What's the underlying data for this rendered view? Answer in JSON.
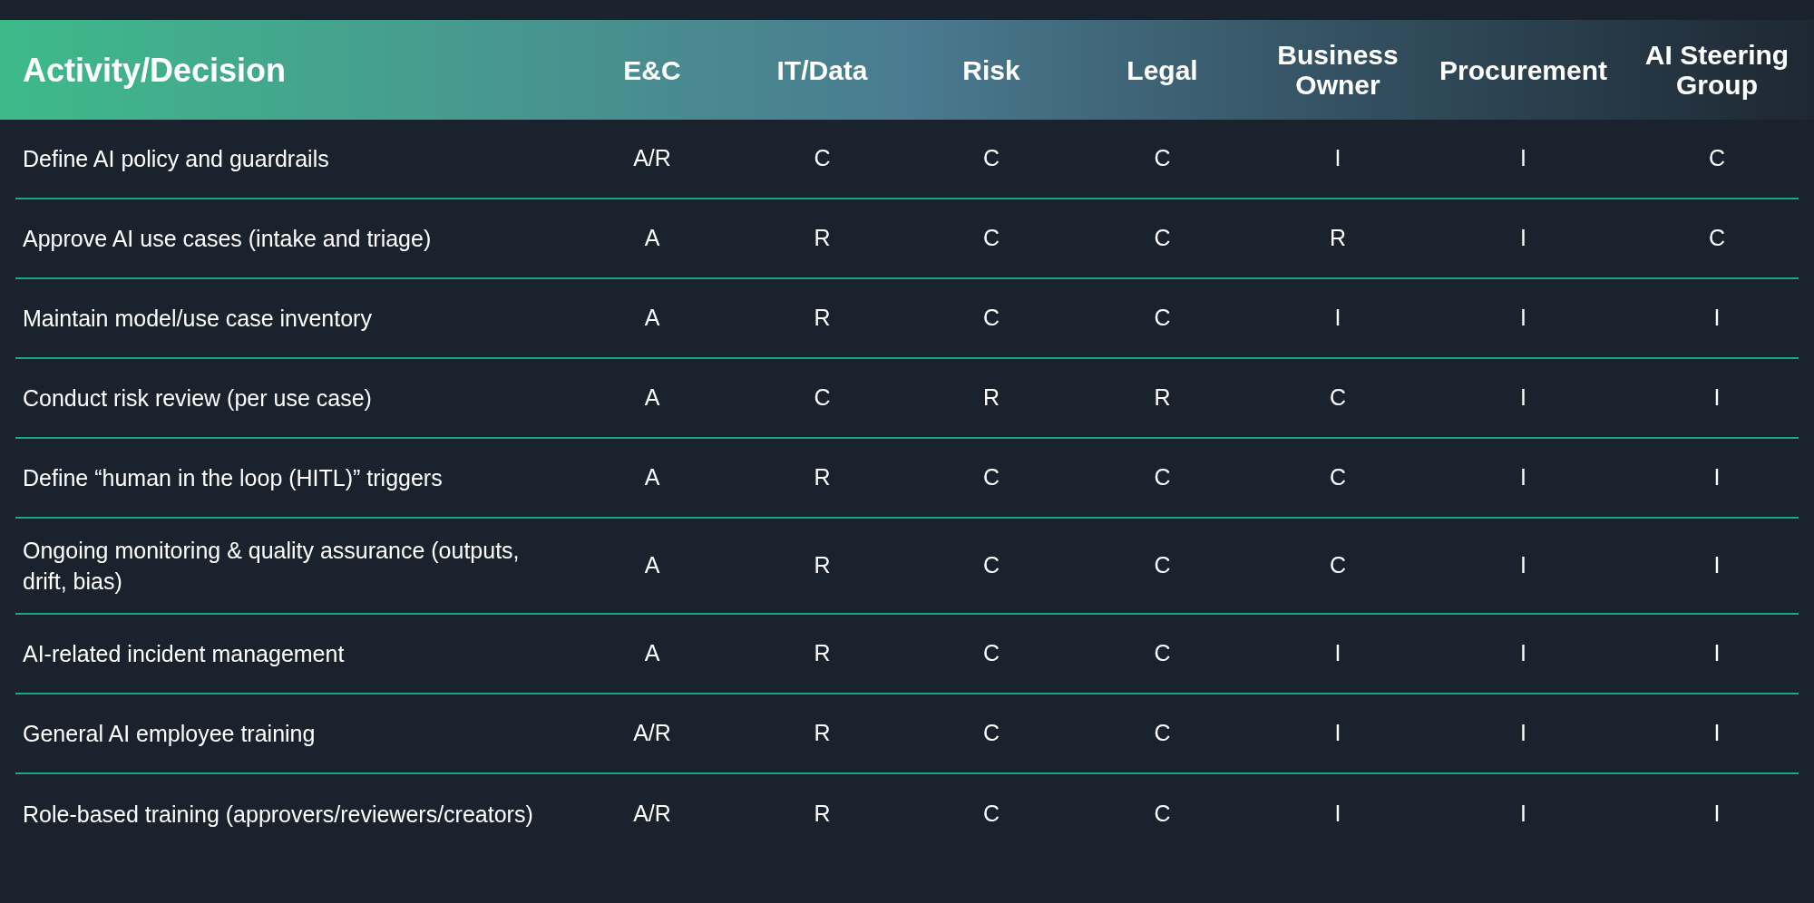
{
  "table": {
    "columns": [
      "Activity/Decision",
      "E&C",
      "IT/Data",
      "Risk",
      "Legal",
      "Business Owner",
      "Procurement",
      "AI Steering Group"
    ],
    "rows": [
      {
        "cells": [
          "Define AI policy and guardrails",
          "A/R",
          "C",
          "C",
          "C",
          "I",
          "I",
          "C"
        ]
      },
      {
        "cells": [
          "Approve AI use cases (intake and triage)",
          "A",
          "R",
          "C",
          "C",
          "R",
          "I",
          "C"
        ]
      },
      {
        "cells": [
          "Maintain model/use case inventory",
          "A",
          "R",
          "C",
          "C",
          "I",
          "I",
          "I"
        ]
      },
      {
        "cells": [
          "Conduct risk review (per use case)",
          "A",
          "C",
          "R",
          "R",
          "C",
          "I",
          "I"
        ]
      },
      {
        "cells": [
          "Define “human in the loop (HITL)” triggers",
          "A",
          "R",
          "C",
          "C",
          "C",
          "I",
          "I"
        ]
      },
      {
        "cells": [
          "Ongoing monitoring & quality assurance (outputs, drift, bias)",
          "A",
          "R",
          "C",
          "C",
          "C",
          "I",
          "I"
        ]
      },
      {
        "cells": [
          "AI-related incident management",
          "A",
          "R",
          "C",
          "C",
          "I",
          "I",
          "I"
        ]
      },
      {
        "cells": [
          "General AI employee training",
          "A/R",
          "R",
          "C",
          "C",
          "I",
          "I",
          "I"
        ]
      },
      {
        "cells": [
          "Role-based training (approvers/reviewers/creators)",
          "A/R",
          "R",
          "C",
          "C",
          "I",
          "I",
          "I"
        ]
      }
    ]
  }
}
